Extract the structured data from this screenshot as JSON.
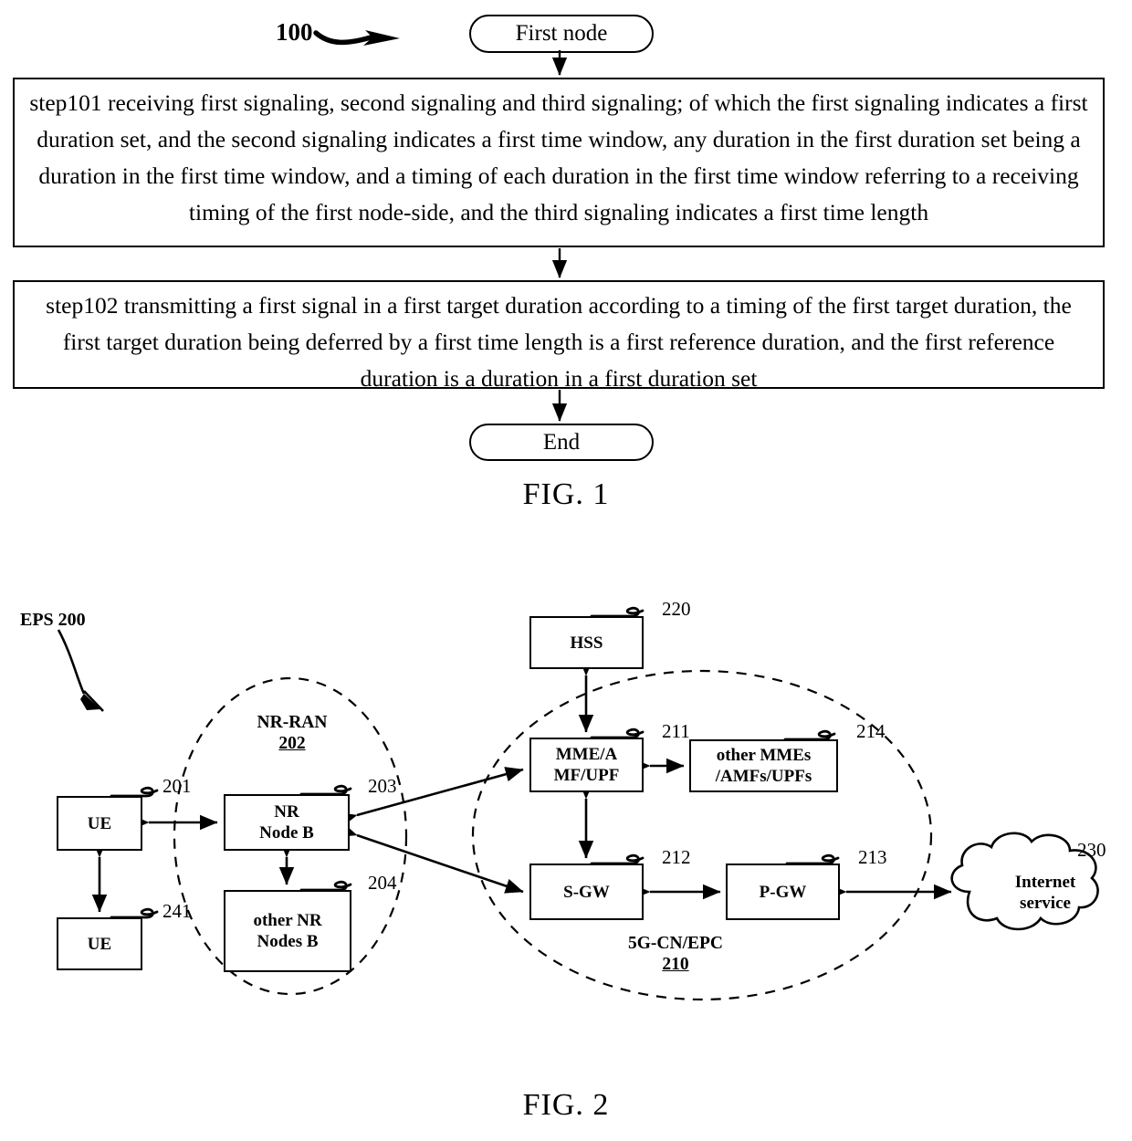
{
  "figure1": {
    "ref": "100",
    "start_node": "First node",
    "end_node": "End",
    "caption": "FIG. 1",
    "steps": [
      {
        "id": "step101",
        "text": "step101 receiving first signaling, second signaling and third signaling; of which the first signaling indicates a first duration set, and the second signaling indicates a first time window, any duration in the first duration set being a duration in the first time window, and a timing of each duration in the first time window referring to a receiving timing of the first node-side, and the third signaling indicates a first time length"
      },
      {
        "id": "step102",
        "text": "step102 transmitting a first signal in a first target duration according to a timing of the first target duration, the first target duration being deferred by a first time length is a first reference duration, and the first reference duration is a duration in a first duration set"
      }
    ]
  },
  "figure2": {
    "caption": "FIG. 2",
    "system_label": "EPS 200",
    "groups": [
      {
        "name": "NR-RAN",
        "ref": "202"
      },
      {
        "name": "5G-CN/EPC",
        "ref": "210"
      }
    ],
    "nodes": [
      {
        "key": "ue1",
        "label": [
          "UE"
        ],
        "ref": "201"
      },
      {
        "key": "ue2",
        "label": [
          "UE"
        ],
        "ref": "241"
      },
      {
        "key": "nr_node_b",
        "label": [
          "NR",
          "Node B"
        ],
        "ref": "203"
      },
      {
        "key": "other_nr",
        "label": [
          "other NR",
          "Nodes B"
        ],
        "ref": "204"
      },
      {
        "key": "hss",
        "label": [
          "HSS"
        ],
        "ref": "220"
      },
      {
        "key": "mme",
        "label": [
          "MME/A",
          "MF/UPF"
        ],
        "ref": "211"
      },
      {
        "key": "other_mme",
        "label": [
          "other MMEs",
          "/AMFs/UPFs"
        ],
        "ref": "214"
      },
      {
        "key": "sgw",
        "label": [
          "S-GW"
        ],
        "ref": "212"
      },
      {
        "key": "pgw",
        "label": [
          "P-GW"
        ],
        "ref": "213"
      },
      {
        "key": "internet",
        "label": [
          "Internet",
          "service"
        ],
        "ref": "230"
      }
    ]
  },
  "colors": {
    "stroke": "#000000",
    "background": "#ffffff"
  }
}
